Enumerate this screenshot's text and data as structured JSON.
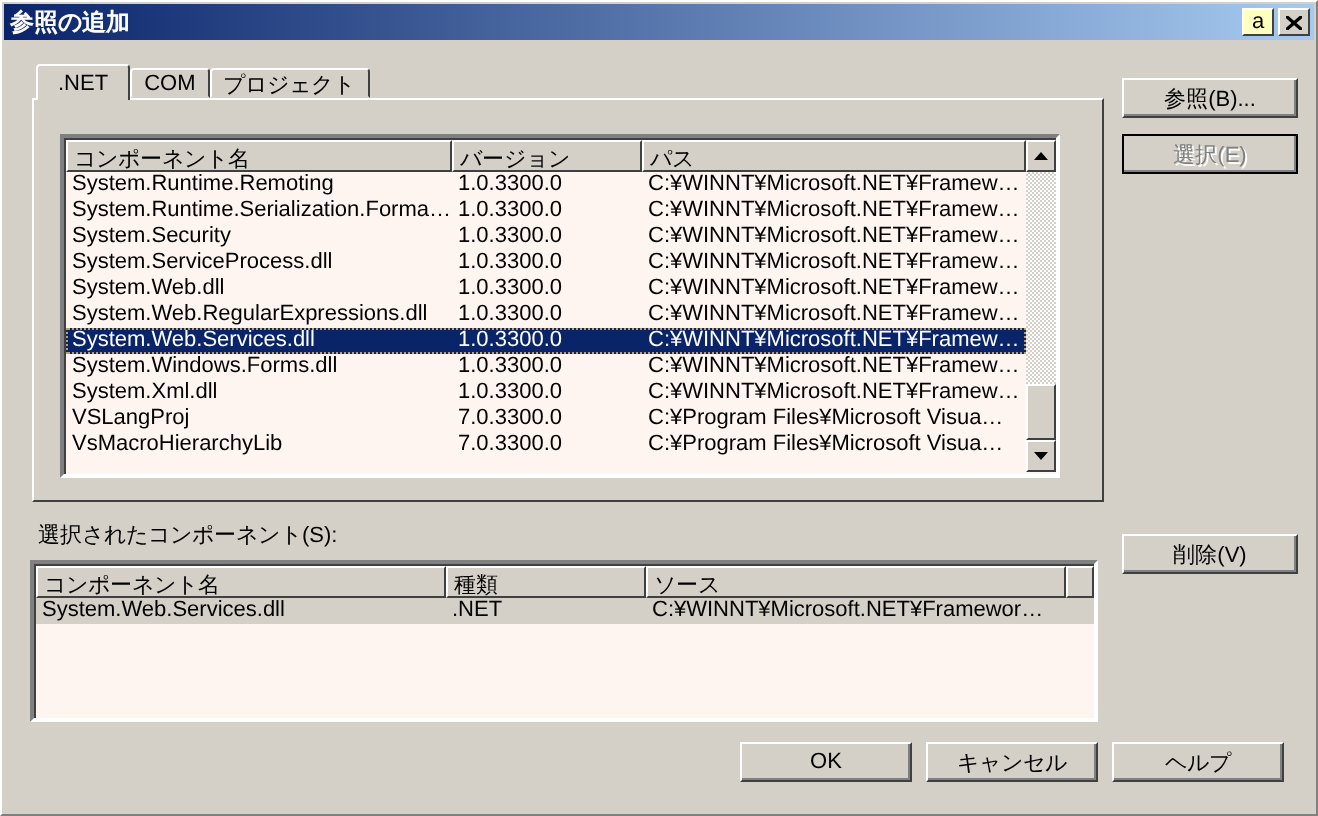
{
  "window": {
    "title": "参照の追加",
    "title_buttons": [
      "a"
    ]
  },
  "tabs": [
    {
      "label": ".NET",
      "selected": true
    },
    {
      "label": "COM",
      "selected": false
    },
    {
      "label": "プロジェクト",
      "selected": false
    }
  ],
  "components": {
    "columns": [
      "コンポーネント名",
      "バージョン",
      "パス"
    ],
    "rows": [
      {
        "cells": [
          "System.Runtime.Remoting",
          "1.0.3300.0",
          "C:¥WINNT¥Microsoft.NET¥Framew…"
        ],
        "selected": false
      },
      {
        "cells": [
          "System.Runtime.Serialization.Forma…",
          "1.0.3300.0",
          "C:¥WINNT¥Microsoft.NET¥Framew…"
        ],
        "selected": false
      },
      {
        "cells": [
          "System.Security",
          "1.0.3300.0",
          "C:¥WINNT¥Microsoft.NET¥Framew…"
        ],
        "selected": false
      },
      {
        "cells": [
          "System.ServiceProcess.dll",
          "1.0.3300.0",
          "C:¥WINNT¥Microsoft.NET¥Framew…"
        ],
        "selected": false
      },
      {
        "cells": [
          "System.Web.dll",
          "1.0.3300.0",
          "C:¥WINNT¥Microsoft.NET¥Framew…"
        ],
        "selected": false
      },
      {
        "cells": [
          "System.Web.RegularExpressions.dll",
          "1.0.3300.0",
          "C:¥WINNT¥Microsoft.NET¥Framew…"
        ],
        "selected": false
      },
      {
        "cells": [
          "System.Web.Services.dll",
          "1.0.3300.0",
          "C:¥WINNT¥Microsoft.NET¥Framew…"
        ],
        "selected": true
      },
      {
        "cells": [
          "System.Windows.Forms.dll",
          "1.0.3300.0",
          "C:¥WINNT¥Microsoft.NET¥Framew…"
        ],
        "selected": false
      },
      {
        "cells": [
          "System.Xml.dll",
          "1.0.3300.0",
          "C:¥WINNT¥Microsoft.NET¥Framew…"
        ],
        "selected": false
      },
      {
        "cells": [
          "VSLangProj",
          "7.0.3300.0",
          "C:¥Program Files¥Microsoft Visua…"
        ],
        "selected": false
      },
      {
        "cells": [
          "VsMacroHierarchyLib",
          "7.0.3300.0",
          "C:¥Program Files¥Microsoft Visua…"
        ],
        "selected": false
      }
    ]
  },
  "side_buttons": [
    {
      "label": "参照(B)...",
      "disabled": false
    },
    {
      "label": "選択(E)",
      "disabled": true
    }
  ],
  "selected_label": "選択されたコンポーネント(S):",
  "selected_components": {
    "columns": [
      "コンポーネント名",
      "種類",
      "ソース"
    ],
    "rows": [
      {
        "cells": [
          "System.Web.Services.dll",
          ".NET",
          "C:¥WINNT¥Microsoft.NET¥Framewor…"
        ],
        "selected": true
      }
    ]
  },
  "remove_button": {
    "label": "削除(V)",
    "disabled": false
  },
  "buttons": [
    "OK",
    "キャンセル",
    "ヘルプ"
  ]
}
